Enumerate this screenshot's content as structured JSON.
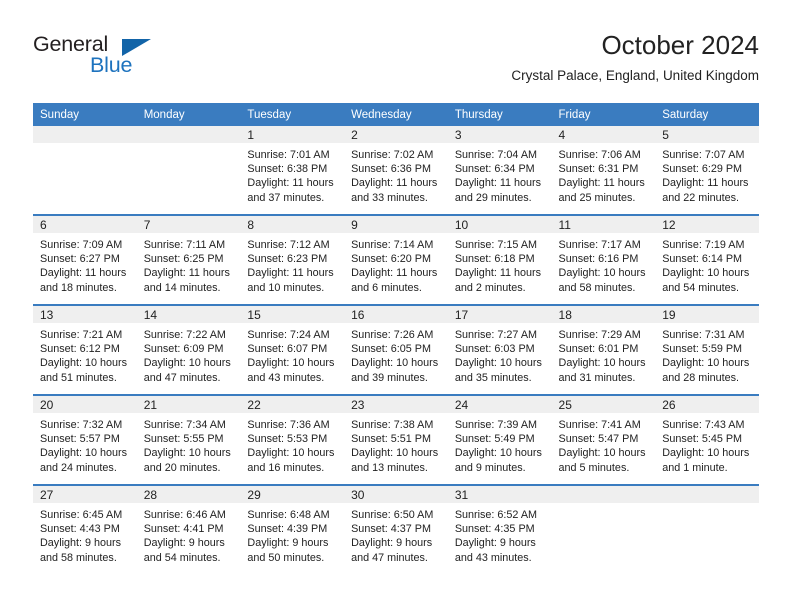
{
  "logo": {
    "word_top": "General",
    "word_bottom": "Blue",
    "accent_color": "#1264a8",
    "text_color": "#231f20"
  },
  "header": {
    "title": "October 2024",
    "subtitle": "Crystal Palace, England, United Kingdom"
  },
  "theme": {
    "header_band": "#3a7cc0",
    "daynum_band": "#efefef",
    "text": "#222222"
  },
  "weekdays": [
    "Sunday",
    "Monday",
    "Tuesday",
    "Wednesday",
    "Thursday",
    "Friday",
    "Saturday"
  ],
  "weeks": [
    [
      {
        "day": "",
        "sunrise": "",
        "sunset": "",
        "daylight1": "",
        "daylight2": ""
      },
      {
        "day": "",
        "sunrise": "",
        "sunset": "",
        "daylight1": "",
        "daylight2": ""
      },
      {
        "day": "1",
        "sunrise": "Sunrise: 7:01 AM",
        "sunset": "Sunset: 6:38 PM",
        "daylight1": "Daylight: 11 hours",
        "daylight2": "and 37 minutes."
      },
      {
        "day": "2",
        "sunrise": "Sunrise: 7:02 AM",
        "sunset": "Sunset: 6:36 PM",
        "daylight1": "Daylight: 11 hours",
        "daylight2": "and 33 minutes."
      },
      {
        "day": "3",
        "sunrise": "Sunrise: 7:04 AM",
        "sunset": "Sunset: 6:34 PM",
        "daylight1": "Daylight: 11 hours",
        "daylight2": "and 29 minutes."
      },
      {
        "day": "4",
        "sunrise": "Sunrise: 7:06 AM",
        "sunset": "Sunset: 6:31 PM",
        "daylight1": "Daylight: 11 hours",
        "daylight2": "and 25 minutes."
      },
      {
        "day": "5",
        "sunrise": "Sunrise: 7:07 AM",
        "sunset": "Sunset: 6:29 PM",
        "daylight1": "Daylight: 11 hours",
        "daylight2": "and 22 minutes."
      }
    ],
    [
      {
        "day": "6",
        "sunrise": "Sunrise: 7:09 AM",
        "sunset": "Sunset: 6:27 PM",
        "daylight1": "Daylight: 11 hours",
        "daylight2": "and 18 minutes."
      },
      {
        "day": "7",
        "sunrise": "Sunrise: 7:11 AM",
        "sunset": "Sunset: 6:25 PM",
        "daylight1": "Daylight: 11 hours",
        "daylight2": "and 14 minutes."
      },
      {
        "day": "8",
        "sunrise": "Sunrise: 7:12 AM",
        "sunset": "Sunset: 6:23 PM",
        "daylight1": "Daylight: 11 hours",
        "daylight2": "and 10 minutes."
      },
      {
        "day": "9",
        "sunrise": "Sunrise: 7:14 AM",
        "sunset": "Sunset: 6:20 PM",
        "daylight1": "Daylight: 11 hours",
        "daylight2": "and 6 minutes."
      },
      {
        "day": "10",
        "sunrise": "Sunrise: 7:15 AM",
        "sunset": "Sunset: 6:18 PM",
        "daylight1": "Daylight: 11 hours",
        "daylight2": "and 2 minutes."
      },
      {
        "day": "11",
        "sunrise": "Sunrise: 7:17 AM",
        "sunset": "Sunset: 6:16 PM",
        "daylight1": "Daylight: 10 hours",
        "daylight2": "and 58 minutes."
      },
      {
        "day": "12",
        "sunrise": "Sunrise: 7:19 AM",
        "sunset": "Sunset: 6:14 PM",
        "daylight1": "Daylight: 10 hours",
        "daylight2": "and 54 minutes."
      }
    ],
    [
      {
        "day": "13",
        "sunrise": "Sunrise: 7:21 AM",
        "sunset": "Sunset: 6:12 PM",
        "daylight1": "Daylight: 10 hours",
        "daylight2": "and 51 minutes."
      },
      {
        "day": "14",
        "sunrise": "Sunrise: 7:22 AM",
        "sunset": "Sunset: 6:09 PM",
        "daylight1": "Daylight: 10 hours",
        "daylight2": "and 47 minutes."
      },
      {
        "day": "15",
        "sunrise": "Sunrise: 7:24 AM",
        "sunset": "Sunset: 6:07 PM",
        "daylight1": "Daylight: 10 hours",
        "daylight2": "and 43 minutes."
      },
      {
        "day": "16",
        "sunrise": "Sunrise: 7:26 AM",
        "sunset": "Sunset: 6:05 PM",
        "daylight1": "Daylight: 10 hours",
        "daylight2": "and 39 minutes."
      },
      {
        "day": "17",
        "sunrise": "Sunrise: 7:27 AM",
        "sunset": "Sunset: 6:03 PM",
        "daylight1": "Daylight: 10 hours",
        "daylight2": "and 35 minutes."
      },
      {
        "day": "18",
        "sunrise": "Sunrise: 7:29 AM",
        "sunset": "Sunset: 6:01 PM",
        "daylight1": "Daylight: 10 hours",
        "daylight2": "and 31 minutes."
      },
      {
        "day": "19",
        "sunrise": "Sunrise: 7:31 AM",
        "sunset": "Sunset: 5:59 PM",
        "daylight1": "Daylight: 10 hours",
        "daylight2": "and 28 minutes."
      }
    ],
    [
      {
        "day": "20",
        "sunrise": "Sunrise: 7:32 AM",
        "sunset": "Sunset: 5:57 PM",
        "daylight1": "Daylight: 10 hours",
        "daylight2": "and 24 minutes."
      },
      {
        "day": "21",
        "sunrise": "Sunrise: 7:34 AM",
        "sunset": "Sunset: 5:55 PM",
        "daylight1": "Daylight: 10 hours",
        "daylight2": "and 20 minutes."
      },
      {
        "day": "22",
        "sunrise": "Sunrise: 7:36 AM",
        "sunset": "Sunset: 5:53 PM",
        "daylight1": "Daylight: 10 hours",
        "daylight2": "and 16 minutes."
      },
      {
        "day": "23",
        "sunrise": "Sunrise: 7:38 AM",
        "sunset": "Sunset: 5:51 PM",
        "daylight1": "Daylight: 10 hours",
        "daylight2": "and 13 minutes."
      },
      {
        "day": "24",
        "sunrise": "Sunrise: 7:39 AM",
        "sunset": "Sunset: 5:49 PM",
        "daylight1": "Daylight: 10 hours",
        "daylight2": "and 9 minutes."
      },
      {
        "day": "25",
        "sunrise": "Sunrise: 7:41 AM",
        "sunset": "Sunset: 5:47 PM",
        "daylight1": "Daylight: 10 hours",
        "daylight2": "and 5 minutes."
      },
      {
        "day": "26",
        "sunrise": "Sunrise: 7:43 AM",
        "sunset": "Sunset: 5:45 PM",
        "daylight1": "Daylight: 10 hours",
        "daylight2": "and 1 minute."
      }
    ],
    [
      {
        "day": "27",
        "sunrise": "Sunrise: 6:45 AM",
        "sunset": "Sunset: 4:43 PM",
        "daylight1": "Daylight: 9 hours",
        "daylight2": "and 58 minutes."
      },
      {
        "day": "28",
        "sunrise": "Sunrise: 6:46 AM",
        "sunset": "Sunset: 4:41 PM",
        "daylight1": "Daylight: 9 hours",
        "daylight2": "and 54 minutes."
      },
      {
        "day": "29",
        "sunrise": "Sunrise: 6:48 AM",
        "sunset": "Sunset: 4:39 PM",
        "daylight1": "Daylight: 9 hours",
        "daylight2": "and 50 minutes."
      },
      {
        "day": "30",
        "sunrise": "Sunrise: 6:50 AM",
        "sunset": "Sunset: 4:37 PM",
        "daylight1": "Daylight: 9 hours",
        "daylight2": "and 47 minutes."
      },
      {
        "day": "31",
        "sunrise": "Sunrise: 6:52 AM",
        "sunset": "Sunset: 4:35 PM",
        "daylight1": "Daylight: 9 hours",
        "daylight2": "and 43 minutes."
      },
      {
        "day": "",
        "sunrise": "",
        "sunset": "",
        "daylight1": "",
        "daylight2": ""
      },
      {
        "day": "",
        "sunrise": "",
        "sunset": "",
        "daylight1": "",
        "daylight2": ""
      }
    ]
  ]
}
